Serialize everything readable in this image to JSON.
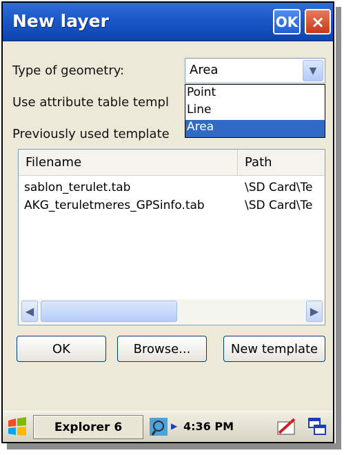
{
  "window": {
    "title": "New layer",
    "ok_label": "OK",
    "close_label": "×"
  },
  "form": {
    "geometry_label": "Type of geometry:",
    "geometry_value": "Area",
    "template_label": "Use attribute table templ",
    "previous_label": "Previously used template",
    "dropdown_options": [
      "Point",
      "Line",
      "Area"
    ],
    "dropdown_selected": "Area"
  },
  "table": {
    "columns": [
      "Filename",
      "Path"
    ],
    "rows": [
      {
        "filename": "sablon_terulet.tab",
        "path": "\\SD Card\\Te"
      },
      {
        "filename": "AKG_teruletmeres_GPSinfo.tab",
        "path": "\\SD Card\\Te"
      }
    ]
  },
  "buttons": {
    "ok": "OK",
    "browse": "Browse...",
    "new_template": "New template"
  },
  "taskbar": {
    "task_label": "Explorer 6",
    "clock": "4:36 PM"
  },
  "colors": {
    "titlebar": "#1c58c8",
    "selection": "#316ac5",
    "dialog_bg": "#ece9d8"
  }
}
